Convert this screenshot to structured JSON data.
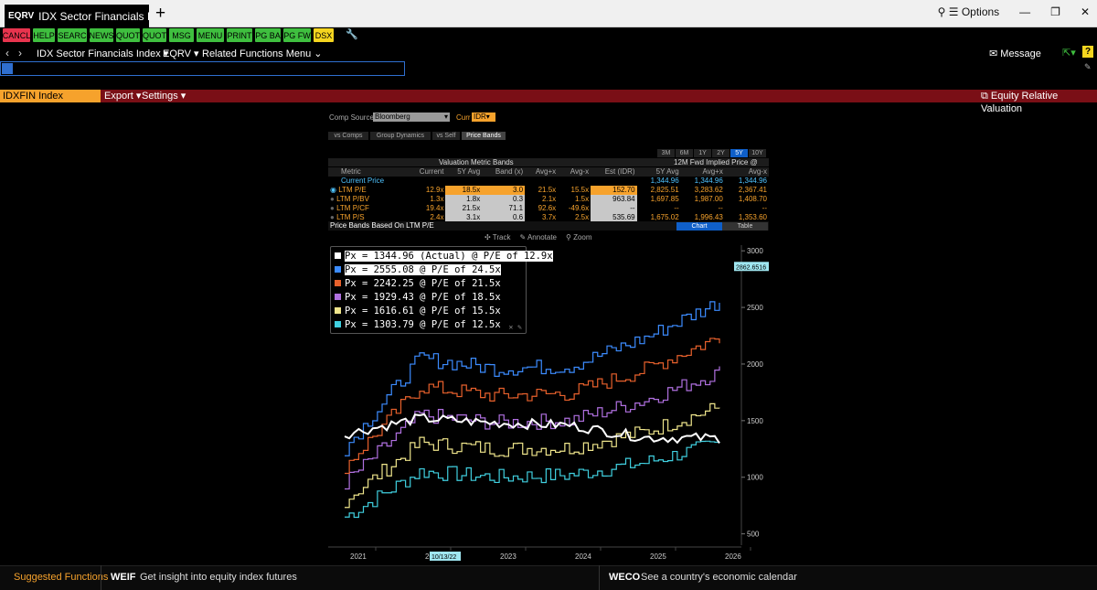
{
  "window": {
    "tab_code": "EQRV",
    "tab_title": "IDX Sector Financials Index",
    "options_label": "Options"
  },
  "toolbar": {
    "buttons": [
      {
        "label": "CANCL",
        "color": "#e8344e"
      },
      {
        "label": "HELP",
        "color": "#3fbf3f"
      },
      {
        "label": "SEARC",
        "color": "#3fbf3f"
      },
      {
        "label": "NEWS",
        "color": "#3fbf3f"
      },
      {
        "label": "QUOT",
        "color": "#3fbf3f"
      },
      {
        "label": "QUOT",
        "color": "#3fbf3f"
      },
      {
        "label": "MSG",
        "color": "#3fbf3f"
      },
      {
        "label": "MENU",
        "color": "#3fbf3f"
      },
      {
        "label": "PRINT",
        "color": "#3fbf3f"
      },
      {
        "label": "PG BA",
        "color": "#3fbf3f"
      },
      {
        "label": "PG FW",
        "color": "#3fbf3f"
      },
      {
        "label": "DSX",
        "color": "#f5d51f"
      }
    ]
  },
  "nav": {
    "security": "IDX Sector Financials Index",
    "function": "EQRV",
    "related": "Related Functions Menu",
    "message": "Message"
  },
  "redbar": {
    "ticker": "IDXFIN Index",
    "export": "Export",
    "settings": "Settings",
    "title": "Equity Relative Valuation"
  },
  "controls": {
    "comp_source_label": "Comp Source",
    "comp_source_value": "Bloomberg",
    "curr_label": "Curr",
    "curr_value": "IDR",
    "tabs": [
      "vs Comps",
      "Group Dynamics",
      "vs Self",
      "Price Bands"
    ],
    "active_tab": "Price Bands",
    "periods": [
      "3M",
      "6M",
      "1Y",
      "2Y",
      "5Y",
      "10Y"
    ],
    "active_period": "5Y"
  },
  "table": {
    "group_header": "Valuation Metric Bands",
    "implied_header": "12M Fwd Implied Price @",
    "columns": [
      "Metric",
      "Current",
      "5Y Avg",
      "Band (x)",
      "Avg+x",
      "Avg-x",
      "Est (IDR)",
      "5Y Avg",
      "Avg+x",
      "Avg-x"
    ],
    "current_price_label": "Current Price",
    "current_price_values": [
      "1,344.96",
      "1,344.96",
      "1,344.96"
    ],
    "rows": [
      {
        "metric": "LTM P/E",
        "current": "12.9x",
        "avg": "18.5x",
        "band": "3.0",
        "plus": "21.5x",
        "minus": "15.5x",
        "est": "152.70",
        "i1": "2,825.51",
        "i2": "3,283.62",
        "i3": "2,367.41",
        "selected": true
      },
      {
        "metric": "LTM P/BV",
        "current": "1.3x",
        "avg": "1.8x",
        "band": "0.3",
        "plus": "2.1x",
        "minus": "1.5x",
        "est": "963.84",
        "i1": "1,697.85",
        "i2": "1,987.00",
        "i3": "1,408.70",
        "selected": false
      },
      {
        "metric": "LTM P/CF",
        "current": "19.4x",
        "avg": "21.5x",
        "band": "71.1",
        "plus": "92.6x",
        "minus": "-49.6x",
        "est": "--",
        "i1": "--",
        "i2": "--",
        "i3": "--",
        "selected": false
      },
      {
        "metric": "LTM P/S",
        "current": "2.4x",
        "avg": "3.1x",
        "band": "0.6",
        "plus": "3.7x",
        "minus": "2.5x",
        "est": "535.69",
        "i1": "1,675.02",
        "i2": "1,996.43",
        "i3": "1,353.60",
        "selected": false
      }
    ],
    "bands_caption": "Price Bands Based On LTM P/E",
    "chart_btn": "Chart",
    "table_btn": "Table"
  },
  "chart_tools": [
    "Track",
    "Annotate",
    "Zoom"
  ],
  "legend": [
    {
      "text": "Px = 1344.96 (Actual) @ P/E of 12.9x",
      "color": "#ffffff"
    },
    {
      "text": "Px = 2555.08 @ P/E of 24.5x",
      "color": "#3c8cff"
    },
    {
      "text": "Px = 2242.25 @ P/E of 21.5x",
      "color": "#e8612c"
    },
    {
      "text": "Px = 1929.43 @ P/E of 18.5x",
      "color": "#b070e0"
    },
    {
      "text": "Px = 1616.61 @ P/E of 15.5x",
      "color": "#f0e68c"
    },
    {
      "text": "Px = 1303.79 @ P/E of 12.5x",
      "color": "#40d0e0"
    }
  ],
  "chart_data": {
    "type": "line",
    "x": [
      "2021",
      "2022",
      "2023",
      "2024",
      "2025",
      "2026"
    ],
    "ylim": [
      400,
      3050
    ],
    "yticks": [
      500,
      1000,
      1500,
      2000,
      2500,
      3000
    ],
    "last_value_label": "2862.6516",
    "cursor_date": "10/13/22",
    "series": [
      {
        "name": "Px = 1303.79 @ P/E of 12.5x",
        "color": "#40d0e0",
        "values": [
          650,
          1050,
          1000,
          1020,
          1130,
          1300
        ]
      },
      {
        "name": "Px = 1616.61 @ P/E of 15.5x",
        "color": "#f0e68c",
        "values": [
          800,
          1300,
          1250,
          1260,
          1400,
          1620
        ]
      },
      {
        "name": "Px = 1929.43 @ P/E of 18.5x",
        "color": "#b070e0",
        "values": [
          950,
          1550,
          1480,
          1500,
          1680,
          1930
        ]
      },
      {
        "name": "Px = 2242.25 @ P/E of 21.5x",
        "color": "#e8612c",
        "values": [
          1100,
          1800,
          1720,
          1740,
          1950,
          2240
        ]
      },
      {
        "name": "Px = 2555.08 @ P/E of 24.5x",
        "color": "#3c8cff",
        "values": [
          1260,
          2050,
          1960,
          1980,
          2230,
          2555
        ]
      },
      {
        "name": "Px = 1344.96 (Actual) @ P/E of 12.9x",
        "color": "#ffffff",
        "values": [
          1380,
          1520,
          1480,
          1460,
          1350,
          1345
        ]
      }
    ]
  },
  "bottom": {
    "suggested": "Suggested Functions",
    "f1_code": "WEIF",
    "f1_text": "Get insight into equity index futures",
    "f2_code": "WECO",
    "f2_text": "See a country's economic calendar"
  }
}
